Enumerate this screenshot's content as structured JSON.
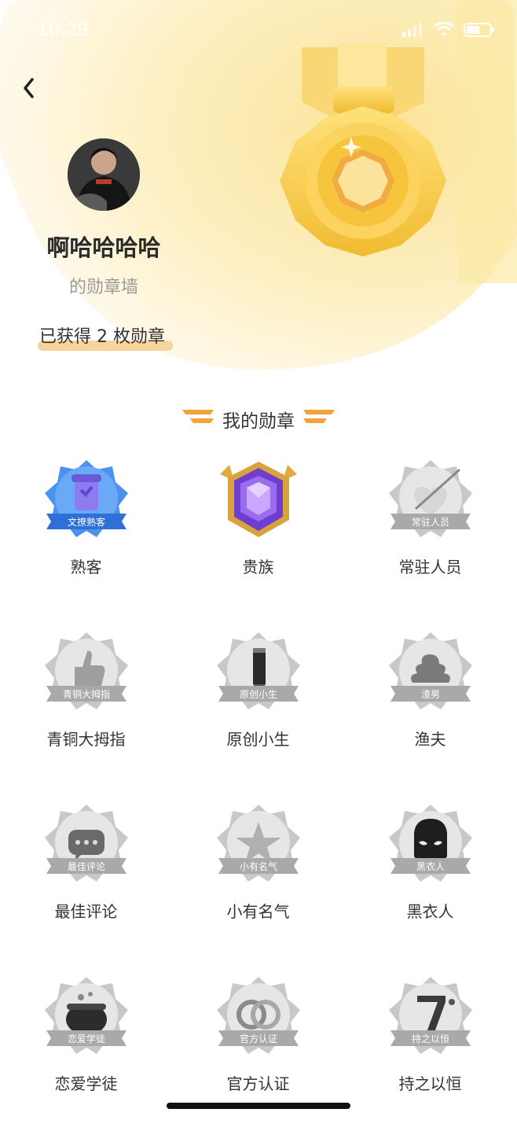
{
  "status_bar": {
    "time": "10:29"
  },
  "profile": {
    "username": "啊哈哈哈哈",
    "subtitle": "的勋章墙",
    "badge_count_text": "已获得 2 枚勋章"
  },
  "section": {
    "title": "我的勋章"
  },
  "colors": {
    "hero_yellow": "#fbe79d",
    "accent_orange": "#f2a43a",
    "highlight": "#f7d49b",
    "locked_gray": "#bdbdbd",
    "blue_badge": "#3d8bf0",
    "purple_badge": "#7a45d6"
  },
  "badges": [
    {
      "name": "熟客",
      "ribbon": "文撩熟客",
      "state": "earned",
      "icon": "cup-icon"
    },
    {
      "name": "贵族",
      "ribbon": "",
      "state": "earned",
      "icon": "gem-icon"
    },
    {
      "name": "常驻人员",
      "ribbon": "常驻人员",
      "state": "locked",
      "icon": "heart-arrow-icon"
    },
    {
      "name": "青铜大拇指",
      "ribbon": "青铜大拇指",
      "state": "locked",
      "icon": "thumbs-up-icon"
    },
    {
      "name": "原创小生",
      "ribbon": "原创小生",
      "state": "locked",
      "icon": "pencil-icon"
    },
    {
      "name": "渔夫",
      "ribbon": "渣男",
      "state": "locked",
      "icon": "swirl-icon"
    },
    {
      "name": "最佳评论",
      "ribbon": "最佳评论",
      "state": "locked",
      "icon": "comment-icon"
    },
    {
      "name": "小有名气",
      "ribbon": "小有名气",
      "state": "locked",
      "icon": "star-icon"
    },
    {
      "name": "黑衣人",
      "ribbon": "黑衣人",
      "state": "locked",
      "icon": "mask-icon"
    },
    {
      "name": "恋爱学徒",
      "ribbon": "恋爱学徒",
      "state": "locked",
      "icon": "cauldron-icon"
    },
    {
      "name": "官方认证",
      "ribbon": "官方认证",
      "state": "locked",
      "icon": "rings-icon"
    },
    {
      "name": "持之以恒",
      "ribbon": "持之以恒",
      "state": "locked",
      "icon": "number-seven-icon"
    }
  ]
}
